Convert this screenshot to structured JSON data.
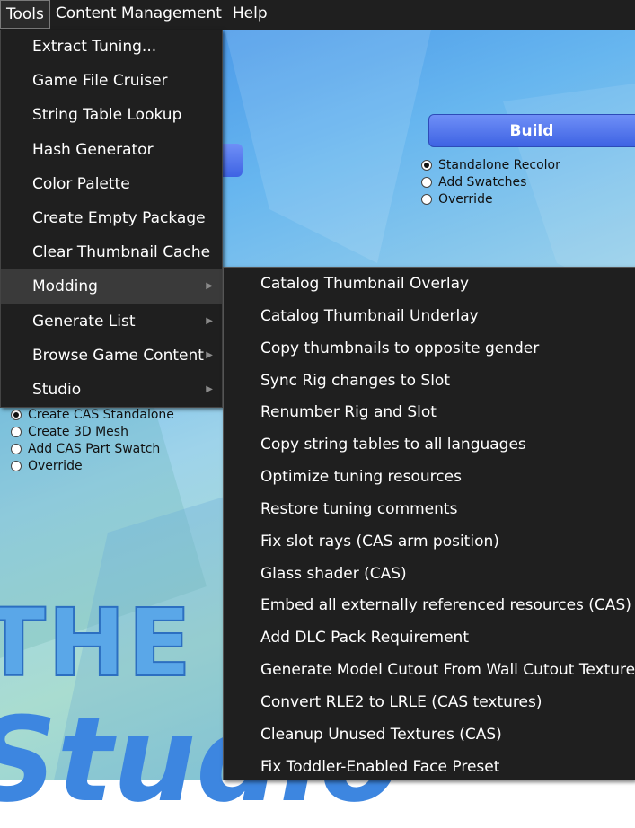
{
  "menubar": {
    "items": [
      {
        "label": "Tools"
      },
      {
        "label": "Content Management"
      },
      {
        "label": "Help"
      }
    ]
  },
  "tools_menu": {
    "items": [
      {
        "label": "Extract Tuning...",
        "submenu": false
      },
      {
        "label": "Game File Cruiser",
        "submenu": false
      },
      {
        "label": "String Table Lookup",
        "submenu": false
      },
      {
        "label": "Hash Generator",
        "submenu": false
      },
      {
        "label": "Color Palette",
        "submenu": false
      },
      {
        "label": "Create Empty Package",
        "submenu": false
      },
      {
        "label": "Clear Thumbnail Cache",
        "submenu": false
      },
      {
        "label": "Modding",
        "submenu": true
      },
      {
        "label": "Generate List",
        "submenu": true
      },
      {
        "label": "Browse Game Content",
        "submenu": true
      },
      {
        "label": "Studio",
        "submenu": true
      }
    ],
    "arrow_glyph": "▶"
  },
  "modding_menu": {
    "items": [
      {
        "label": "Catalog Thumbnail Overlay"
      },
      {
        "label": "Catalog Thumbnail Underlay"
      },
      {
        "label": "Copy thumbnails to opposite gender"
      },
      {
        "label": "Sync Rig changes to Slot"
      },
      {
        "label": "Renumber Rig and Slot"
      },
      {
        "label": "Copy string tables to all languages"
      },
      {
        "label": "Optimize tuning resources"
      },
      {
        "label": "Restore tuning comments"
      },
      {
        "label": "Fix slot rays (CAS arm position)"
      },
      {
        "label": "Glass shader (CAS)"
      },
      {
        "label": "Embed all externally referenced resources (CAS)"
      },
      {
        "label": "Add DLC Pack Requirement"
      },
      {
        "label": "Generate Model Cutout From Wall Cutout Texture"
      },
      {
        "label": "Convert RLE2 to LRLE (CAS textures)"
      },
      {
        "label": "Cleanup Unused Textures (CAS)"
      },
      {
        "label": "Fix Toddler-Enabled Face Preset"
      }
    ]
  },
  "build_panel": {
    "button_label": "Build",
    "options": [
      {
        "label": "Standalone Recolor",
        "checked": true
      },
      {
        "label": "Add Swatches",
        "checked": false
      },
      {
        "label": "Override",
        "checked": false
      }
    ]
  },
  "cas_panel": {
    "options": [
      {
        "label": "Create CAS Standalone",
        "checked": true
      },
      {
        "label": "Create 3D Mesh",
        "checked": false
      },
      {
        "label": "Add CAS Part Swatch",
        "checked": false
      },
      {
        "label": "Override",
        "checked": false
      }
    ]
  },
  "logo": {
    "line1": "THE SIMS",
    "line2": "Studio"
  }
}
